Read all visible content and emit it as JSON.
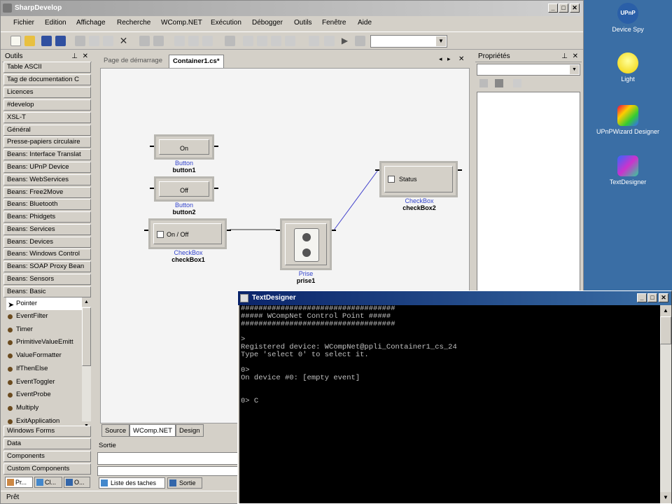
{
  "window": {
    "title": "SharpDevelop",
    "min": "_",
    "max": "□",
    "close": "✕"
  },
  "menu": [
    "Fichier",
    "Edition",
    "Affichage",
    "Recherche",
    "WComp.NET",
    "Exécution",
    "Débogger",
    "Outils",
    "Fenêtre",
    "Aide"
  ],
  "toolpanel": {
    "title": "Outils",
    "categories": [
      "Table ASCII",
      "Tag de documentation C",
      "Licences",
      "#develop",
      "XSL-T",
      "Général",
      "Presse-papiers circulaire",
      "Beans: Interface Translat",
      "Beans: UPnP Device",
      "Beans: WebServices",
      "Beans: Free2Move",
      "Beans: Bluetooth",
      "Beans: Phidgets",
      "Beans: Services",
      "Beans: Devices",
      "Beans: Windows Control",
      "Beans: SOAP Proxy Bean",
      "Beans: Sensors",
      "Beans: Basic"
    ],
    "items": [
      "Pointer",
      "EventFilter",
      "Timer",
      "PrimitiveValueEmitt",
      "ValueFormatter",
      "IfThenElse",
      "EventToggler",
      "EventProbe",
      "Multiply",
      "ExitApplication"
    ],
    "bottom_categories": [
      "Windows Forms",
      "Data",
      "Components",
      "Custom Components"
    ],
    "bottom_tabs": [
      "Pr...",
      "Cl...",
      "O..."
    ]
  },
  "designer": {
    "tabs": [
      "Page de démarrage",
      "Container1.cs*"
    ],
    "bottom_tabs": [
      "Source",
      "WComp.NET",
      "Design"
    ],
    "blocks": {
      "button1": {
        "label": "On",
        "type": "Button",
        "name": "button1"
      },
      "button2": {
        "label": "Off",
        "type": "Button",
        "name": "button2"
      },
      "checkbox1": {
        "label": "On / Off",
        "type": "CheckBox",
        "name": "checkBox1"
      },
      "prise1": {
        "type": "Prise",
        "name": "prise1"
      },
      "checkbox2": {
        "label": "Status",
        "type": "CheckBox",
        "name": "checkBox2"
      }
    }
  },
  "properties": {
    "title": "Propriétés"
  },
  "output": {
    "title": "Sortie",
    "tabs": [
      "Liste des taches",
      "Sortie"
    ]
  },
  "status": "Prêt",
  "console": {
    "title": "TextDesigner",
    "lines": [
      "###################################",
      "##### WCompNet Control Point #####",
      "###################################",
      "",
      ">",
      "Registered device: WCompNet@ppli_Container1_cs_24",
      "Type 'select 0' to select it.",
      "",
      "0>",
      "On device #0: [empty event]",
      "",
      "",
      "0> C"
    ]
  },
  "desktop": [
    "Device Spy",
    "Light",
    "UPnPWizard Designer",
    "TextDesigner"
  ],
  "desktop_badge": "UPnP"
}
